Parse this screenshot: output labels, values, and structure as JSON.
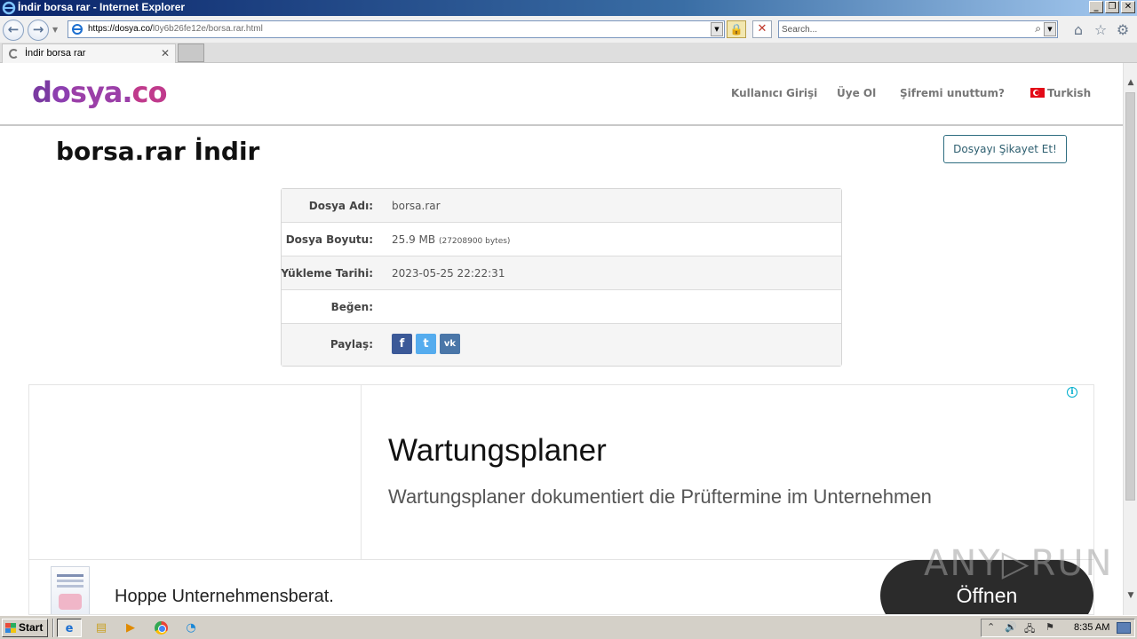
{
  "window": {
    "title": "İndir borsa rar - Internet Explorer",
    "buttons": [
      "_",
      "❐",
      "✕"
    ]
  },
  "browser": {
    "url_host": "https://dosya.co/",
    "url_path": "l0y6b26fe12e/borsa.rar.html",
    "search_placeholder": "Search...",
    "tab_label": "İndir borsa rar"
  },
  "site": {
    "logo": {
      "d": "d",
      "o": "o",
      "mid": "sya.",
      "co": "co"
    },
    "nav": {
      "login": "Kullanıcı Girişi",
      "signup": "Üye Ol",
      "forgot": "Şifremi unuttum?",
      "language": "Turkish"
    },
    "page_title": "borsa.rar İndir",
    "complain_button": "Dosyayı Şikayet Et!"
  },
  "file_info": {
    "rows": [
      {
        "label": "Dosya Adı:",
        "value": "borsa.rar"
      },
      {
        "label": "Dosya Boyutu:",
        "value": "25.9 MB",
        "extra": "(27208900 bytes)"
      },
      {
        "label": "Yükleme Tarihi:",
        "value": "2023-05-25 22:22:31"
      },
      {
        "label": "Beğen:",
        "value": ""
      },
      {
        "label": "Paylaş:"
      }
    ],
    "share": [
      "f",
      "t",
      "vk"
    ]
  },
  "ad": {
    "info_icon": "i",
    "headline": "Wartungsplaner",
    "description": "Wartungsplaner dokumentiert die Prüftermine im Unternehmen",
    "advertiser": "Hoppe Unternehmensberat.",
    "cta": "Öffnen"
  },
  "watermark": "ANY▷RUN",
  "taskbar": {
    "start": "Start",
    "clock": "8:35 AM"
  },
  "colors": {
    "logo_purple": "#7b3aa2",
    "logo_pink": "#c03a8c",
    "facebook": "#3b5998",
    "twitter": "#55acee",
    "vk": "#4a76a8",
    "cta_bg": "#2b2b2b"
  }
}
